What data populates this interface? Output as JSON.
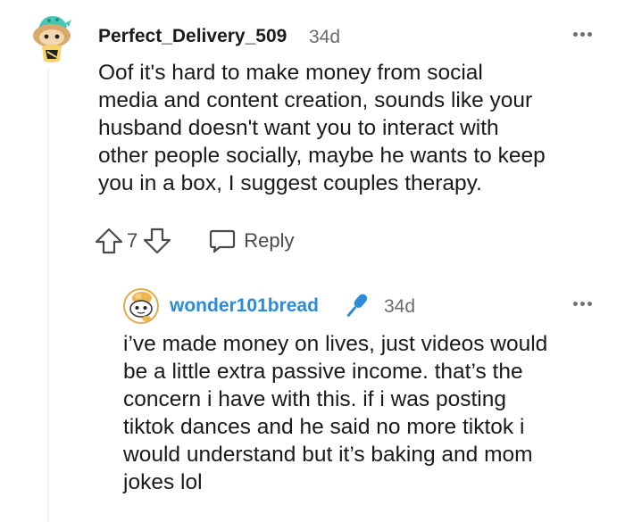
{
  "comment": {
    "username": "Perfect_Delivery_509",
    "age": "34d",
    "body": "Oof it's hard to make money from social\nmedia and content creation, sounds like your\nhusband doesn't want you to interact with\nother people socially, maybe he wants to keep\nyou in a box, I suggest couples therapy.",
    "votes": "7",
    "reply_label": "Reply",
    "avatar_icon": "snoo-avatar-icon",
    "more_icon": "more-options-icon"
  },
  "reply": {
    "username": "wonder101bread",
    "username_color": "#2a8bd8",
    "age": "34d",
    "flair_icon": "microphone-icon",
    "body": "i’ve made money on lives, just videos would\nbe a little extra passive income. that’s the\nconcern i have with this. if i was posting\ntiktok dances and he said no more tiktok i\nwould understand but it’s baking and mom\njokes lol",
    "avatar_icon": "snoo-avatar-icon",
    "more_icon": "more-options-icon"
  },
  "colors": {
    "accent_blue": "#2a8bd8",
    "thread_line": "#edeff1",
    "meta_gray": "#6b6b6b"
  }
}
